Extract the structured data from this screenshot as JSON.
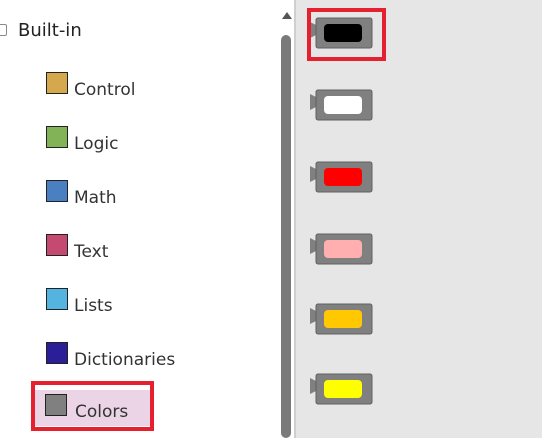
{
  "tree": {
    "root_label": "Built-in",
    "categories": [
      {
        "label": "Control",
        "color": "#d6a84e",
        "selected": false
      },
      {
        "label": "Logic",
        "color": "#82b356",
        "selected": false
      },
      {
        "label": "Math",
        "color": "#4a80c2",
        "selected": false
      },
      {
        "label": "Text",
        "color": "#c44a72",
        "selected": false
      },
      {
        "label": "Lists",
        "color": "#55b3df",
        "selected": false
      },
      {
        "label": "Dictionaries",
        "color": "#2a1f96",
        "selected": false
      },
      {
        "label": "Colors",
        "color": "#808080",
        "selected": true
      }
    ]
  },
  "flyout": {
    "blocks": [
      {
        "name": "color-black-block",
        "color": "#000000",
        "icon": "color-swatch"
      },
      {
        "name": "color-white-block",
        "color": "#ffffff",
        "icon": "color-swatch"
      },
      {
        "name": "color-red-block",
        "color": "#ff0000",
        "icon": "color-swatch"
      },
      {
        "name": "color-pink-block",
        "color": "#ffafaf",
        "icon": "color-swatch"
      },
      {
        "name": "color-orange-block",
        "color": "#ffc800",
        "icon": "color-swatch"
      },
      {
        "name": "color-yellow-block",
        "color": "#ffff00",
        "icon": "color-swatch"
      }
    ]
  },
  "highlight_color": "#e52130",
  "block_body_color": "#808080"
}
